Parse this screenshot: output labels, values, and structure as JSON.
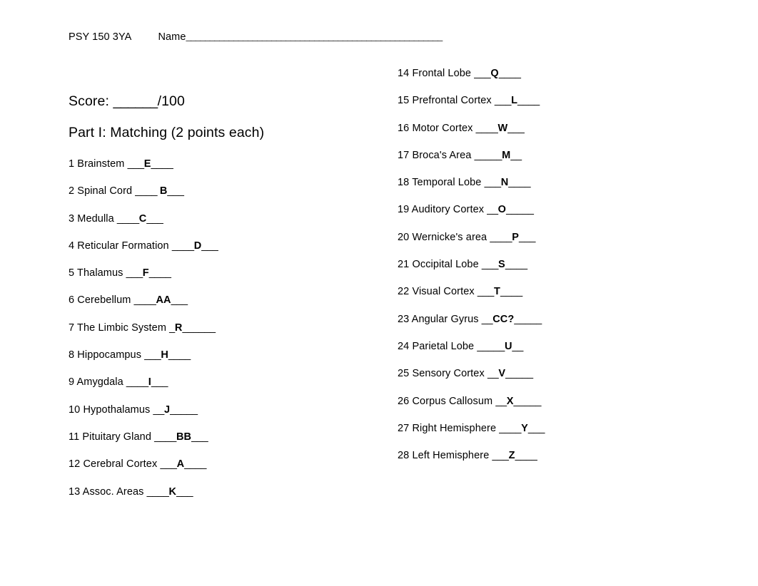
{
  "header": {
    "course_code": "PSY 150 3YA",
    "name_label": "Name",
    "name_rule": "______________________________________________________"
  },
  "score": {
    "label": "Score: ",
    "blank": "______",
    "total": "/100"
  },
  "part_heading": "Part I: Matching (2 points each)",
  "matching": {
    "left_column": [
      {
        "num": "1",
        "label": " Brainstem ",
        "pre": "___",
        "answer": "E",
        "post": "____"
      },
      {
        "num": "2",
        "label": " Spinal Cord ",
        "pre": "____ ",
        "answer": "B",
        "post": "___"
      },
      {
        "num": "3",
        "label": " Medulla ",
        "pre": "____",
        "answer": "C",
        "post": "___"
      },
      {
        "num": "4",
        "label": " Reticular Formation ",
        "pre": "____",
        "answer": "D",
        "post": "___"
      },
      {
        "num": "5",
        "label": " Thalamus ",
        "pre": "___",
        "answer": "F",
        "post": "____"
      },
      {
        "num": "6",
        "label": " Cerebellum ",
        "pre": "____",
        "answer": "AA",
        "post": "___"
      },
      {
        "num": "7",
        "label": " The Limbic System ",
        "pre": "_",
        "answer": "R",
        "post": "______"
      },
      {
        "num": "8",
        "label": " Hippocampus ",
        "pre": "___",
        "answer": "H",
        "post": "____"
      },
      {
        "num": "9",
        "label": " Amygdala ",
        "pre": "____",
        "answer": "I",
        "post": "___"
      },
      {
        "num": "10",
        "label": " Hypothalamus ",
        "pre": "__",
        "answer": "J",
        "post": "_____"
      },
      {
        "num": "11",
        "label": " Pituitary Gland ",
        "pre": "____",
        "answer": "BB",
        "post": "___"
      },
      {
        "num": "12",
        "label": " Cerebral Cortex ",
        "pre": "___",
        "answer": "A",
        "post": "____"
      },
      {
        "num": "13",
        "label": " Assoc. Areas ",
        "pre": "____",
        "answer": "K",
        "post": "___"
      }
    ],
    "right_column": [
      {
        "num": "14",
        "label": " Frontal Lobe ",
        "pre": "___",
        "answer": "Q",
        "post": "____"
      },
      {
        "num": "15",
        "label": " Prefrontal Cortex ",
        "pre": "___",
        "answer": "L",
        "post": "____"
      },
      {
        "num": "16",
        "label": " Motor Cortex ",
        "pre": "____",
        "answer": "W",
        "post": "___"
      },
      {
        "num": "17",
        "label": " Broca's Area ",
        "pre": "_____",
        "answer": "M",
        "post": "__"
      },
      {
        "num": "18",
        "label": " Temporal Lobe ",
        "pre": "___",
        "answer": "N",
        "post": "____"
      },
      {
        "num": "19",
        "label": " Auditory Cortex ",
        "pre": "__",
        "answer": "O",
        "post": "_____"
      },
      {
        "num": "20",
        "label": " Wernicke's area ",
        "pre": "____",
        "answer": "P",
        "post": "___"
      },
      {
        "num": "21",
        "label": " Occipital Lobe ",
        "pre": "___",
        "answer": "S",
        "post": "____"
      },
      {
        "num": "22",
        "label": " Visual Cortex ",
        "pre": "___",
        "answer": "T",
        "post": "____"
      },
      {
        "num": "23",
        "label": " Angular Gyrus ",
        "pre": "__",
        "answer": "CC?",
        "post": "_____"
      },
      {
        "num": "24",
        "label": " Parietal Lobe ",
        "pre": "_____",
        "answer": "U",
        "post": "__"
      },
      {
        "num": "25",
        "label": " Sensory Cortex ",
        "pre": "__",
        "answer": "V",
        "post": "_____"
      },
      {
        "num": "26",
        "label": " Corpus Callosum ",
        "pre": "__",
        "answer": "X",
        "post": "_____"
      },
      {
        "num": "27",
        "label": " Right Hemisphere ",
        "pre": "____",
        "answer": "Y",
        "post": "___"
      },
      {
        "num": "28",
        "label": " Left Hemisphere ",
        "pre": "___",
        "answer": "Z",
        "post": "____"
      }
    ]
  }
}
